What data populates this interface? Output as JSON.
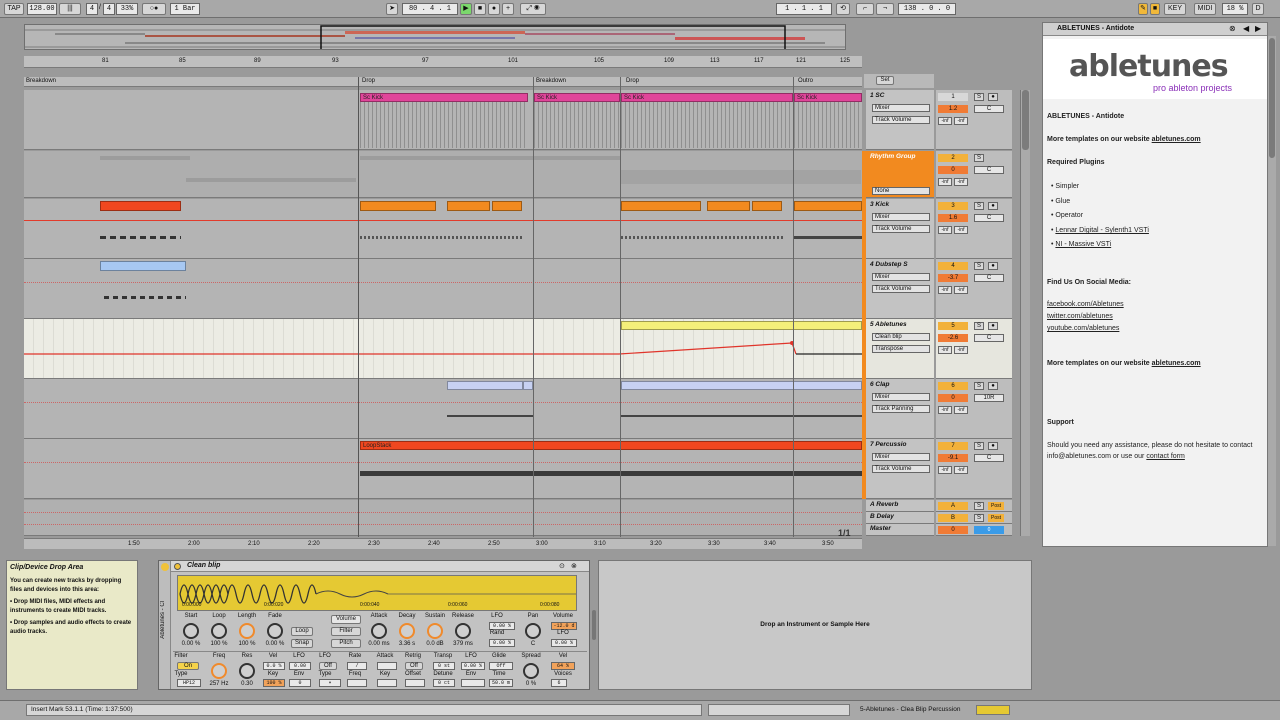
{
  "transport": {
    "tap": "TAP",
    "tempo": "128.00",
    "signature_num": "4",
    "signature_den": "4",
    "zoom": "33%",
    "quantize": "1 Bar",
    "position": "80 . 4 . 1",
    "loop_start": "1 . 1 . 1",
    "loop_length": "138 . 0 . 0",
    "key": "KEY",
    "midi": "MIDI",
    "cpu": "18 %"
  },
  "locators": [
    "Breakdown",
    "Drop",
    "Breakdown",
    "Drop",
    "Outro"
  ],
  "ruler": [
    "81",
    "85",
    "89",
    "93",
    "97",
    "101",
    "105",
    "109",
    "113",
    "117",
    "121",
    "125"
  ],
  "time_ruler": [
    "1:50",
    "2:00",
    "2:10",
    "2:20",
    "2:30",
    "2:40",
    "2:50",
    "3:00",
    "3:10",
    "3:20",
    "3:30",
    "3:40",
    "3:50"
  ],
  "clips": {
    "sc_kick": "Sc Kick",
    "loopstack": "LoopStack"
  },
  "tracks": [
    {
      "name": "1 SC",
      "number": "1",
      "selector": "Mixer",
      "param": "Track Volume",
      "volume": "1.2",
      "pan": "C"
    },
    {
      "name": "Rhythm Group",
      "number": "2",
      "selector": "None",
      "volume": "0",
      "pan": "C"
    },
    {
      "name": "3 Kick",
      "number": "3",
      "selector": "Mixer",
      "param": "Track Volume",
      "volume": "1.6",
      "pan": "C"
    },
    {
      "name": "4 Dubstep S",
      "number": "4",
      "selector": "Mixer",
      "param": "Track Volume",
      "volume": "-3.7",
      "pan": "C"
    },
    {
      "name": "5 Abletunes",
      "number": "5",
      "selector": "Clean blip",
      "param": "Transpose",
      "volume": "-2.6",
      "pan": "C"
    },
    {
      "name": "6 Clap",
      "number": "6",
      "selector": "Mixer",
      "param": "Track Panning",
      "volume": "0",
      "pan": "10R"
    },
    {
      "name": "7 Percussio",
      "number": "7",
      "selector": "Mixer",
      "param": "Track Volume",
      "volume": "-9.1",
      "pan": "C"
    }
  ],
  "returns": [
    {
      "name": "A Reverb",
      "letter": "A",
      "post": "Post"
    },
    {
      "name": "B Delay",
      "letter": "B",
      "post": "Post"
    },
    {
      "name": "Master",
      "letter": "0",
      "post": "0"
    }
  ],
  "mixer": {
    "inf": "-inf",
    "solo": "S",
    "page": "1/1",
    "set": "Set"
  },
  "sidebar": {
    "title": "ABLETUNES - Antidote",
    "logo_main": "abletunes",
    "logo_sub": "pro ableton projects",
    "heading": "ABLETUNES - Antidote",
    "more_templates_prefix": "More templates on our website",
    "website": "abletunes.com",
    "required_plugins": "Required Plugins",
    "plugins": [
      "Simpler",
      "Glue",
      "Operator",
      "Lennar Digital - Sylenth1 VSTi",
      "NI - Massive VSTi"
    ],
    "social_heading": "Find Us On Social Media:",
    "social": [
      "facebook.com/Abletunes",
      "twitter.com/abletunes",
      "youtube.com/abletunes"
    ],
    "support_heading": "Support",
    "support_text": "Should you need any assistance, please do not hesitate to contact info@abletunes.com or use our",
    "contact_link": "contact form"
  },
  "info_view": {
    "title": "Clip/Device Drop Area",
    "intro": "You can create new tracks by dropping files and devices into this area:",
    "bullets": [
      "Drop MIDI files, MIDI effects and instruments to create MIDI tracks.",
      "Drop samples and audio effects to create audio tracks."
    ]
  },
  "device": {
    "name": "Clean blip",
    "side_label": "Abletunes - Cl",
    "waveform_marks": [
      "0:00:000",
      "0:00:020",
      "0:00:040",
      "0:00:060",
      "0:00:080"
    ],
    "knobs": [
      {
        "label": "Start",
        "value": "0.00 %"
      },
      {
        "label": "Loop",
        "value": "100 %"
      },
      {
        "label": "Length",
        "value": "100 %"
      },
      {
        "label": "Fade",
        "value": "0.00 %"
      }
    ],
    "loop_btn": "Loop",
    "snap_btn": "Snap",
    "filter_btn": "Filter",
    "pitch_btn": "Pitch",
    "volume_tab": "Volume",
    "env_knobs": [
      {
        "label": "Attack",
        "value": "0.00 ms"
      },
      {
        "label": "Decay",
        "value": "3.36 s"
      },
      {
        "label": "Sustain",
        "value": "0.0 dB"
      },
      {
        "label": "Release",
        "value": "379 ms"
      }
    ],
    "lfo_label": "LFO",
    "lfo_val": "0.00 %",
    "rand_label": "Rand",
    "rand_val": "0.00 %",
    "pan_label": "Pan",
    "pan_val": "C",
    "vol_label": "Volume",
    "vol_val": "-12.0 d",
    "lfo2_label": "LFO",
    "lfo2_val": "0.00 %",
    "bottom": {
      "filter": "Filter",
      "on": "On",
      "freq": "Freq",
      "res": "Res",
      "vel": "Vel",
      "lfo": "LFO",
      "type": "Type",
      "type_val": "HP12",
      "freq_val": "257 Hz",
      "res_val": "0.30",
      "vel_val": "0.0 %",
      "lfo_val": "0.00",
      "key": "Key",
      "key_val": "100 %",
      "env": "Env",
      "env_val": "0",
      "lfo_off": "Off",
      "lfo_type": "Type",
      "rate": "Rate",
      "attack": "Attack",
      "retrig": "Retrig",
      "off2": "Off",
      "freq2": "Freq",
      "key2": "Key",
      "offset": "Offset",
      "transp": "Transp",
      "transp_val": "0 st",
      "lfo3": "LFO",
      "lfo3_val": "0.00 %",
      "glide": "Glide",
      "glide_val": "Off",
      "detune": "Detune",
      "detune_val": "0 ct",
      "env2": "Env",
      "time": "Time",
      "time_val": "50.0 m",
      "spread": "Spread",
      "spread_val": "0 %",
      "vel2": "Vel",
      "vel2_val": "64 %",
      "voices": "Voices",
      "voices_val": "6"
    }
  },
  "drop_instrument": "Drop an Instrument or Sample Here",
  "status": {
    "left": "Insert Mark 53.1.1 (Time: 1:37:500)",
    "right": "5-Abletunes - Clea Blip Percussion"
  }
}
